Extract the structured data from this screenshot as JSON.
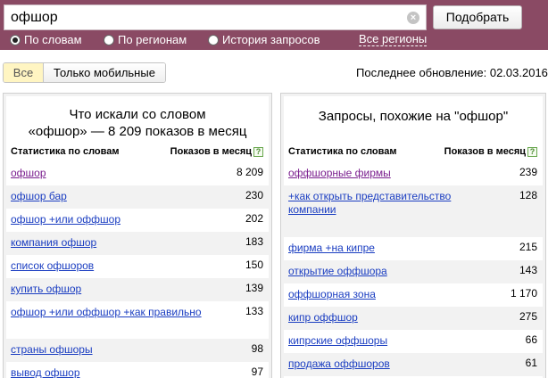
{
  "search": {
    "query": "офшор",
    "submit_label": "Подобрать",
    "modes": [
      {
        "label": "По словам",
        "checked": true
      },
      {
        "label": "По регионам",
        "checked": false
      },
      {
        "label": "История запросов",
        "checked": false
      }
    ],
    "regions_link": "Все регионы"
  },
  "filter": {
    "all_label": "Все",
    "mobile_label": "Только мобильные"
  },
  "last_update": "Последнее обновление: 02.03.2016",
  "left_panel": {
    "title_line1": "Что искали со словом",
    "title_line2": "«офшор» — 8 209 показов в месяц",
    "col_phrase": "Статистика по словам",
    "col_count": "Показов в месяц",
    "rows": [
      {
        "phrase": "офшор",
        "count": "8 209",
        "visited": true
      },
      {
        "phrase": "офшор бар",
        "count": "230",
        "visited": false
      },
      {
        "phrase": "офшор +или оффшор",
        "count": "202",
        "visited": false
      },
      {
        "phrase": "компания офшор",
        "count": "183",
        "visited": false
      },
      {
        "phrase": "список офшоров",
        "count": "150",
        "visited": false
      },
      {
        "phrase": "купить офшор",
        "count": "139",
        "visited": false
      },
      {
        "phrase": "офшор +или оффшор +как правильно",
        "count": "133",
        "visited": false
      },
      {
        "phrase": "страны офшоры",
        "count": "98",
        "visited": false
      },
      {
        "phrase": "вывод офшор",
        "count": "97",
        "visited": false
      }
    ]
  },
  "right_panel": {
    "title": "Запросы, похожие на \"офшор\"",
    "col_phrase": "Статистика по словам",
    "col_count": "Показов в месяц",
    "rows": [
      {
        "phrase": "оффшорные фирмы",
        "count": "239",
        "visited": true
      },
      {
        "phrase": "+как открыть представительство компании",
        "count": "128",
        "visited": false
      },
      {
        "phrase": "фирма +на кипре",
        "count": "215",
        "visited": false
      },
      {
        "phrase": "открытие оффшора",
        "count": "143",
        "visited": false
      },
      {
        "phrase": "оффшорная зона",
        "count": "1 170",
        "visited": false
      },
      {
        "phrase": "кипр оффшор",
        "count": "275",
        "visited": false
      },
      {
        "phrase": "кипрские оффшоры",
        "count": "66",
        "visited": false
      },
      {
        "phrase": "продажа оффшоров",
        "count": "61",
        "visited": false
      }
    ]
  }
}
